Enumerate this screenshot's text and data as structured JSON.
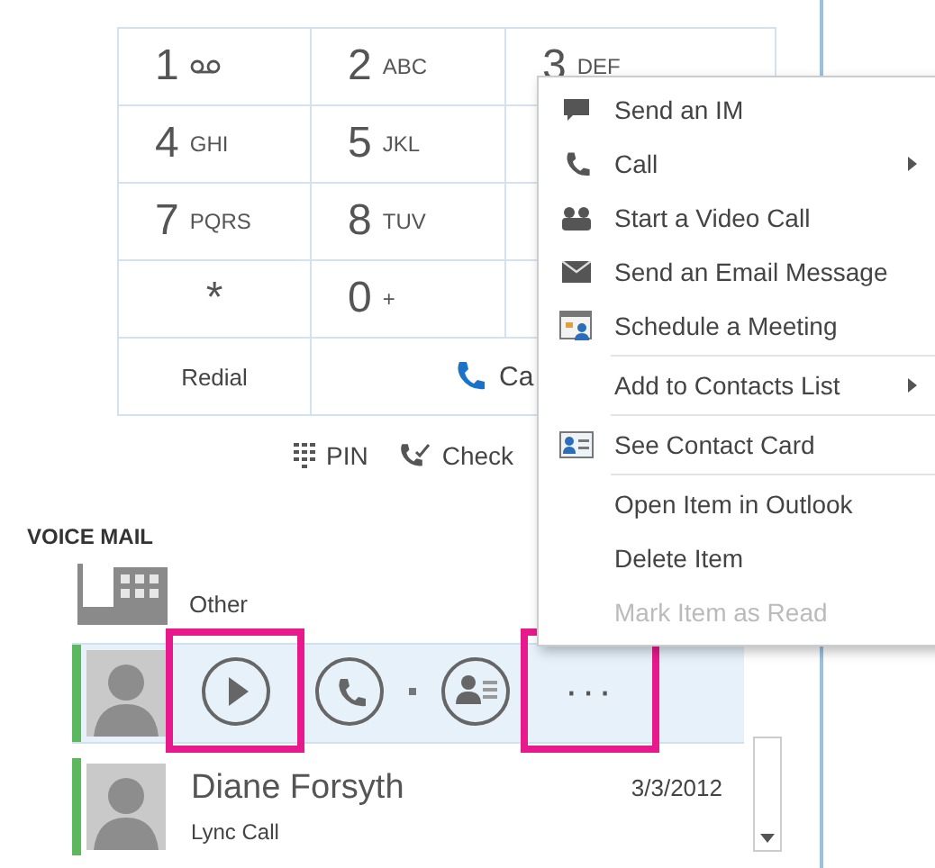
{
  "keypad": {
    "rows": [
      [
        {
          "kind": "voicemail",
          "digit": "1"
        },
        {
          "kind": "digit",
          "digit": "2",
          "letters": "ABC"
        },
        {
          "kind": "digit",
          "digit": "3",
          "letters": "DEF"
        }
      ],
      [
        {
          "kind": "digit",
          "digit": "4",
          "letters": "GHI"
        },
        {
          "kind": "digit",
          "digit": "5",
          "letters": "JKL"
        }
      ],
      [
        {
          "kind": "digit",
          "digit": "7",
          "letters": "PQRS"
        },
        {
          "kind": "digit",
          "digit": "8",
          "letters": "TUV"
        }
      ],
      [
        {
          "kind": "digit",
          "digit": "*"
        },
        {
          "kind": "digit",
          "digit": "0",
          "letters": "+"
        }
      ]
    ],
    "redial": "Redial",
    "call": "Ca"
  },
  "tools": [
    {
      "kind": "pin",
      "label": "PIN"
    },
    {
      "kind": "check",
      "label": "Check"
    }
  ],
  "voice_mail": {
    "title": "VOICE MAIL",
    "group": "Other",
    "items": [
      {
        "selected": true,
        "color": "#5cb85c",
        "actions": [
          {
            "kind": "play",
            "highlighted": true
          },
          {
            "kind": "call",
            "highlighted": false
          },
          {
            "kind": "contact",
            "highlighted": false
          },
          {
            "kind": "more",
            "label": "···",
            "highlighted": true
          }
        ]
      },
      {
        "selected": false,
        "color": "#5cb85c",
        "name": "Diane Forsyth",
        "subtitle": "Lync Call",
        "date": "3/3/2012"
      }
    ]
  },
  "context_menu": {
    "groups": [
      [
        {
          "kind": "im",
          "label": "Send an IM",
          "submenu": false,
          "disabled": false
        },
        {
          "kind": "phone",
          "label": "Call",
          "submenu": true,
          "disabled": false
        },
        {
          "kind": "video",
          "label": "Start a Video Call",
          "submenu": false,
          "disabled": false
        },
        {
          "kind": "mail",
          "label": "Send an Email Message",
          "submenu": false,
          "disabled": false
        },
        {
          "kind": "calendar",
          "label": "Schedule a Meeting",
          "submenu": false,
          "disabled": false
        }
      ],
      [
        {
          "kind": "text",
          "label": "Add to Contacts List",
          "submenu": true,
          "disabled": false
        }
      ],
      [
        {
          "kind": "card",
          "label": "See Contact Card",
          "submenu": false,
          "disabled": false
        }
      ],
      [
        {
          "kind": "text",
          "label": "Open Item in Outlook",
          "submenu": false,
          "disabled": false
        },
        {
          "kind": "text",
          "label": "Delete Item",
          "submenu": false,
          "disabled": false
        },
        {
          "kind": "text",
          "label": "Mark Item as Read",
          "submenu": false,
          "disabled": true
        }
      ]
    ]
  }
}
